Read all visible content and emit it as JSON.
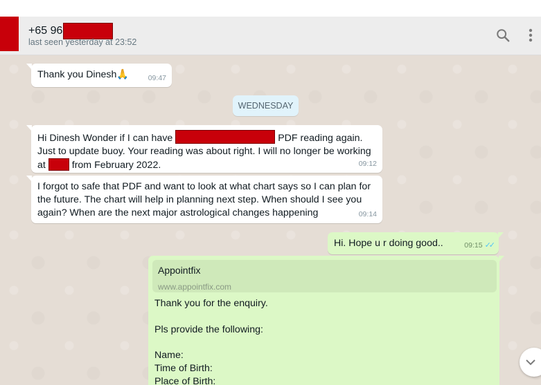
{
  "header": {
    "contact_name": "+65 96",
    "last_seen": "last seen yesterday at 23:52",
    "icons": {
      "search": "search-icon",
      "menu": "kebab-menu-icon"
    }
  },
  "colors": {
    "chat_background": "#e5ddd5",
    "incoming_bubble": "#ffffff",
    "outgoing_bubble": "#dcf8c6",
    "redaction": "#c8000a",
    "read_tick": "#4fc3f7"
  },
  "messages": [
    {
      "direction": "incoming",
      "text": "Thank you Dinesh🙏",
      "time": "09:47"
    },
    {
      "type": "date",
      "text": "WEDNESDAY"
    },
    {
      "direction": "incoming",
      "parts": [
        "Hi Dinesh Wonder if I can have",
        "PDF reading again. Just to update buoy. Your reading was about right. I will no longer be working at",
        "from February 2022."
      ],
      "time": "09:12"
    },
    {
      "direction": "incoming",
      "text": "I forgot to safe that PDF and want to look at what chart says so I can plan for the future. The chart will help in planning next step. When should I see you again? When are the next major astrological changes happening",
      "time": "09:14"
    },
    {
      "direction": "outgoing",
      "text": "Hi. Hope u r doing good..",
      "time": "09:15",
      "status": "read"
    },
    {
      "direction": "outgoing",
      "link_preview": {
        "title": "Appointfix",
        "url": "www.appointfix.com"
      },
      "text": "Thank you for the enquiry.\n\nPls provide the following:\n\nName:\nTime of Birth:\nPlace of Birth:"
    }
  ],
  "scroll_button": {
    "icon": "chevron-down-icon"
  }
}
